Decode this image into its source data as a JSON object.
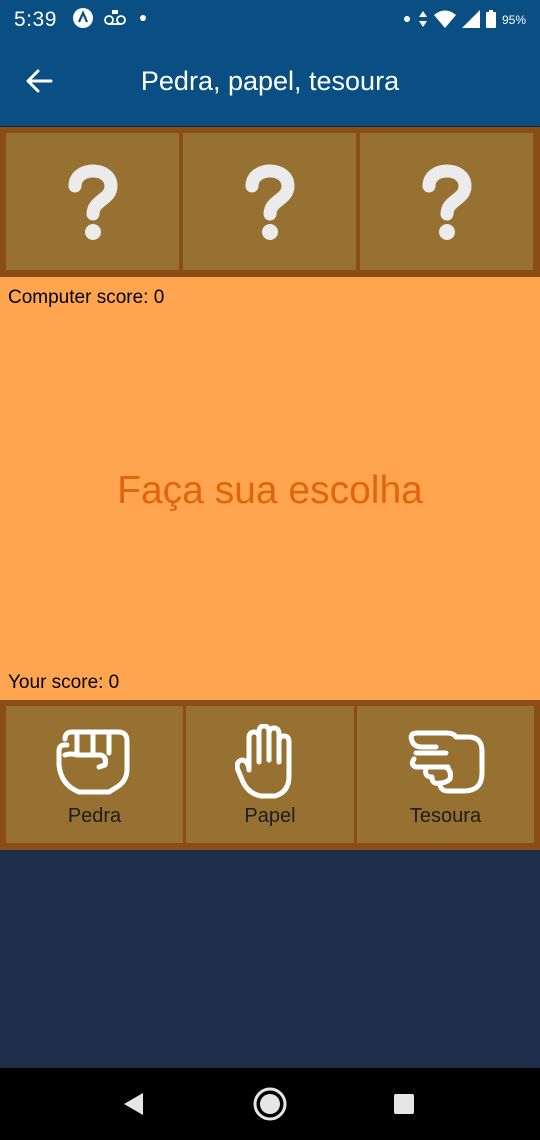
{
  "status_bar": {
    "time": "5:39",
    "battery": "95%",
    "icons": [
      "app-notification-icon",
      "voicemail-icon",
      "dot-icon",
      "data-arrows-icon",
      "wifi-icon",
      "signal-icon",
      "battery-icon"
    ]
  },
  "app_bar": {
    "title": "Pedra, papel, tesoura",
    "back_icon": "arrow-left-icon"
  },
  "computer_choices": [
    "?",
    "?",
    "?"
  ],
  "scores": {
    "computer": "Computer score: 0",
    "player": "Your score: 0"
  },
  "message": "Faça sua escolha",
  "choices": [
    {
      "label": "Pedra",
      "icon": "fist-icon"
    },
    {
      "label": "Papel",
      "icon": "open-hand-icon"
    },
    {
      "label": "Tesoura",
      "icon": "scissors-hand-icon"
    }
  ],
  "colors": {
    "app_bar": "#0a4f83",
    "panel_border": "#8b4d17",
    "tile": "#977132",
    "game_area": "#ffa54f",
    "message": "#e0660b",
    "background": "#1e2f4b"
  }
}
